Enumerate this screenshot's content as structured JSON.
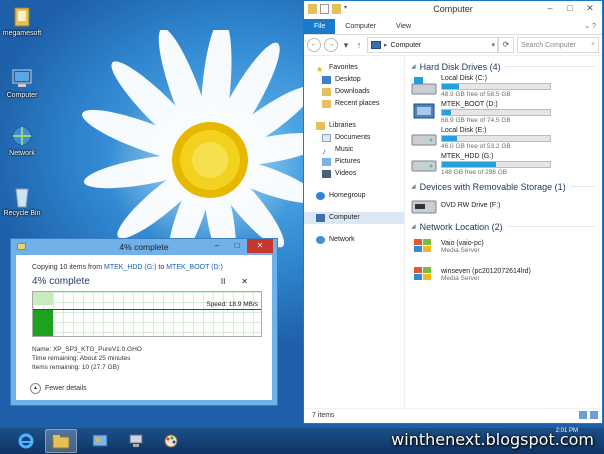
{
  "desktop": {
    "icons": [
      {
        "label": "megamesoft",
        "icon": "folder-icon"
      },
      {
        "label": "Computer",
        "icon": "computer-icon"
      },
      {
        "label": "Network",
        "icon": "network-icon"
      },
      {
        "label": "Recycle Bin",
        "icon": "recycle-bin-icon"
      }
    ]
  },
  "explorer": {
    "title": "Computer",
    "ribbon_tabs": [
      "File",
      "Computer",
      "View"
    ],
    "address": "Computer",
    "search_placeholder": "Search Computer",
    "nav": {
      "favorites": "Favorites",
      "favorites_items": [
        "Desktop",
        "Downloads",
        "Recent places"
      ],
      "libraries": "Libraries",
      "libraries_items": [
        "Documents",
        "Music",
        "Pictures",
        "Videos"
      ],
      "homegroup": "Homegroup",
      "computer": "Computer",
      "network": "Network"
    },
    "groups": {
      "hdd": "Hard Disk Drives (4)",
      "removable": "Devices with Removable Storage (1)",
      "network": "Network Location (2)"
    },
    "drives": [
      {
        "name": "Local Disk (C:)",
        "free": "48.9 GB free of 58.5 GB",
        "used_fraction": 0.16
      },
      {
        "name": "MTEK_BOOT (D:)",
        "free": "68.9 GB free of 74.5 GB",
        "used_fraction": 0.08
      },
      {
        "name": "Local Disk (E:)",
        "free": "46.0 GB free of 53.2 GB",
        "used_fraction": 0.14
      },
      {
        "name": "MTEK_HDD (G:)",
        "free": "148 GB free of 298 GB",
        "used_fraction": 0.5
      }
    ],
    "removable": {
      "name": "DVD RW Drive (F:)"
    },
    "network_locations": [
      {
        "name": "Vaio (vaio-pc)",
        "type": "Media Server"
      },
      {
        "name": "winseven (pc2012072614lrd)",
        "type": "Media Server"
      }
    ],
    "status": "7 items",
    "accent": "#26a0da"
  },
  "copy_dialog": {
    "title": "4% complete",
    "copy_prefix": "Copying 10 items from ",
    "source": "MTEK_HDD (G:)",
    "to": " to ",
    "dest": "MTEK_BOOT (D:)",
    "percent_text": "4% complete",
    "progress_fraction": 0.04,
    "speed": "Speed: 18.9 MB/s",
    "name_line": "Name: XP_SP3_KTG_PureV1.0.GHO",
    "time_line": "Time remaining: About 25 minutes",
    "items_line": "Items remaining: 10 (27.7 GB)",
    "fewer_details": "Fewer details",
    "pause_glyph": "II",
    "close_glyph": "✕"
  },
  "taskbar": {
    "watermark": "winthenext.blogspot.com",
    "clock": "2:01 PM",
    "pins": [
      "internet-explorer-icon",
      "file-explorer-icon",
      "control-panel-icon",
      "network-share-icon",
      "paint-icon"
    ]
  }
}
